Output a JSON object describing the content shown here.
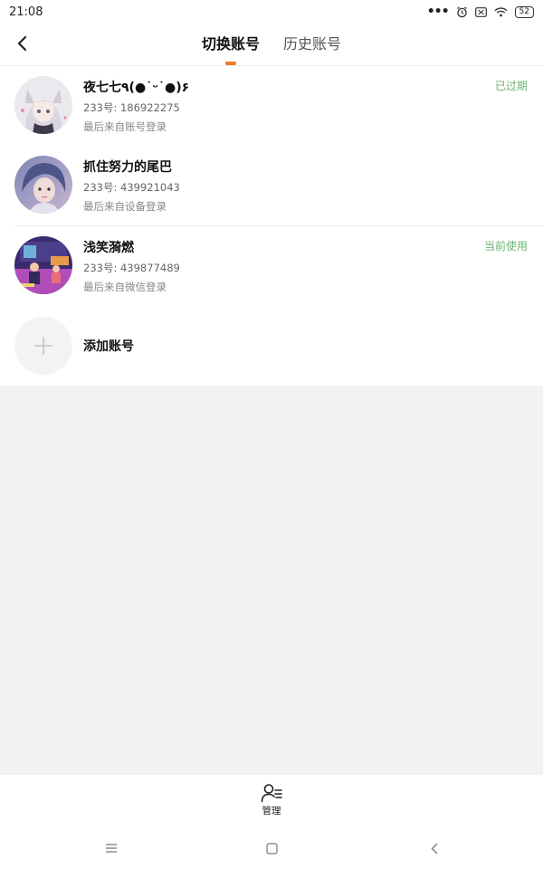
{
  "status_bar": {
    "time": "21:08",
    "battery": "52"
  },
  "header": {
    "tabs": [
      {
        "label": "切换账号",
        "active": true
      },
      {
        "label": "历史账号",
        "active": false
      }
    ]
  },
  "accounts": [
    {
      "name": "夜七七٩(●˙ᵕ˙●)۶",
      "id_text": "233号: 186922275",
      "login_text": "最后来自账号登录",
      "status": "已过期",
      "status_color": "#6cb574"
    },
    {
      "name": "抓住努力的尾巴",
      "id_text": "233号: 439921043",
      "login_text": "最后来自设备登录",
      "status": "",
      "status_color": ""
    },
    {
      "name": "浅笑漪燃",
      "id_text": "233号: 439877489",
      "login_text": "最后来自微信登录",
      "status": "当前使用",
      "status_color": "#6cb574"
    }
  ],
  "add_account": {
    "label": "添加账号"
  },
  "bottom": {
    "manage_label": "管理"
  },
  "colors": {
    "accent": "#f07a26",
    "status_green": "#6cb574",
    "page_bg": "#f2f2f2"
  },
  "icons": [
    "back-icon",
    "alarm-icon",
    "notification-icon",
    "wifi-icon",
    "battery-icon",
    "plus-icon",
    "user-manage-icon",
    "menu-nav-icon",
    "home-nav-icon",
    "back-nav-icon"
  ]
}
